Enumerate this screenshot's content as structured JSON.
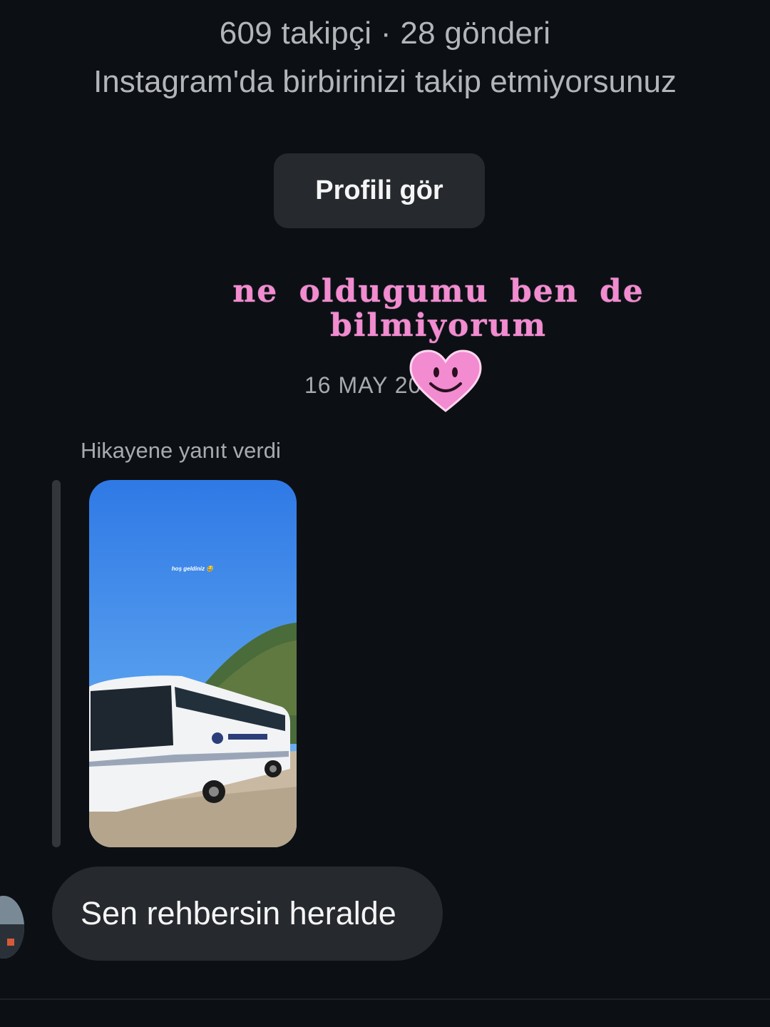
{
  "profile": {
    "stats": "609 takipçi · 28 gönderi",
    "follow_note": "Instagram'da birbirinizi takip etmiyorsunuz",
    "view_profile_label": "Profili gör"
  },
  "sticker": {
    "line1": "ne oldugumu ben de",
    "line2": "bilmiyorum",
    "icon": "smiley-heart-icon",
    "color": "#f28bd0"
  },
  "thread": {
    "date": "16 MAY 20",
    "story_reply_label": "Hikayene yanıt verdi",
    "story_caption": "hoş geldiniz 😂",
    "message": "Sen rehbersin heralde"
  }
}
